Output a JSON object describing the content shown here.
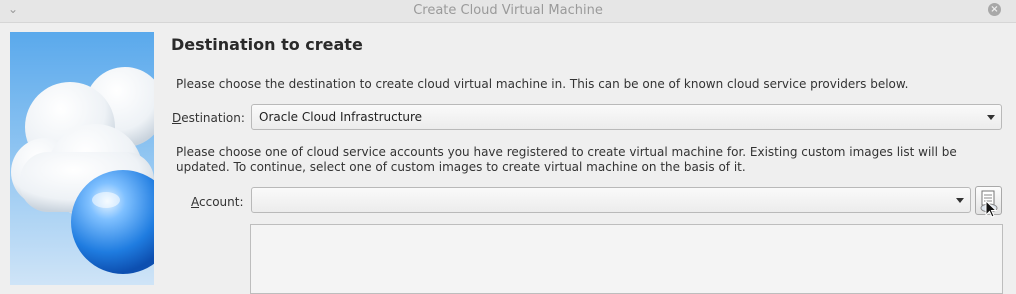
{
  "window": {
    "title": "Create Cloud Virtual Machine"
  },
  "page": {
    "heading": "Destination to create",
    "destination_description": "Please choose the destination to create cloud virtual machine in. This can be one of known cloud service providers below.",
    "destination_label": "Destination:",
    "destination_value": "Oracle Cloud Infrastructure",
    "account_description": "Please choose one of cloud service accounts you have registered to create virtual machine for. Existing custom images list will be updated. To continue, select one of custom images to create virtual machine on the basis of it.",
    "account_label": "Account:",
    "account_value": ""
  },
  "icons": {
    "window_menu": "chevron-down-icon",
    "window_close": "close-icon",
    "side_image": "cloud-globe-icon",
    "account_tool": "cloud-profile-manager-icon"
  }
}
